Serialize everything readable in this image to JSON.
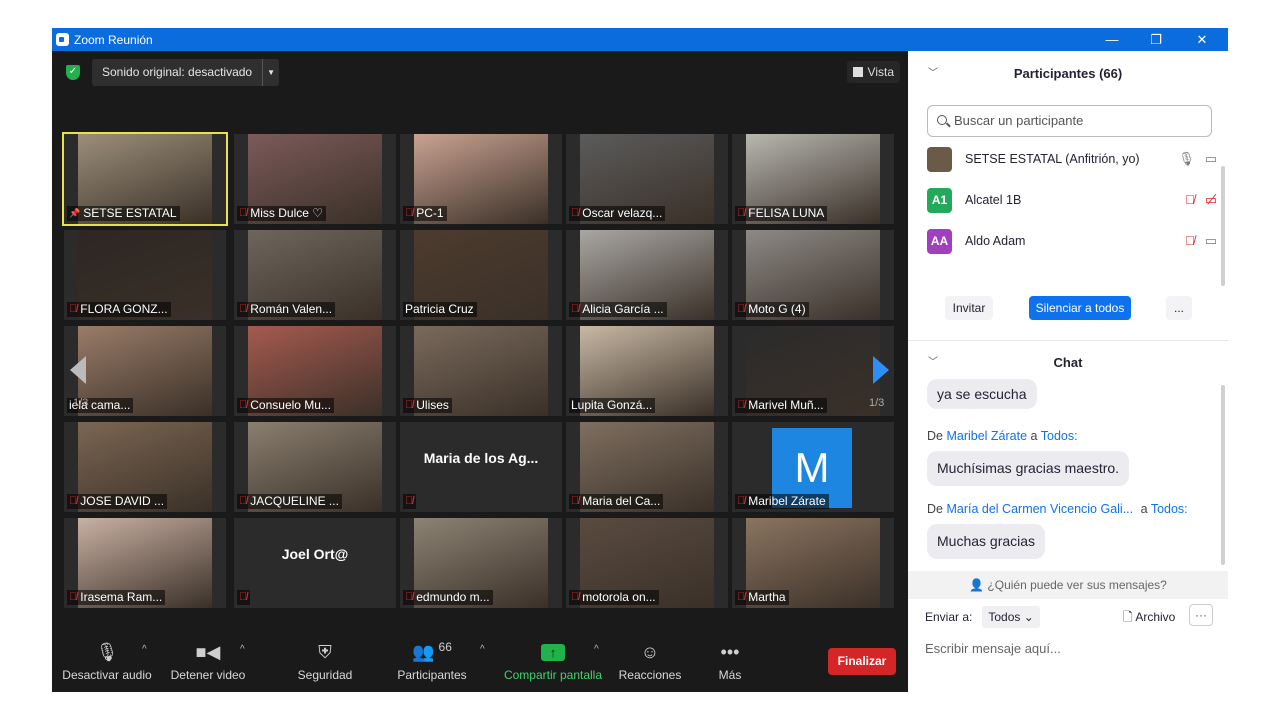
{
  "window": {
    "title": "Zoom Reunión",
    "minimize": "—",
    "restore": "❐",
    "close": "✕"
  },
  "meeting": {
    "sound_button": "Sonido original: desactivado",
    "view_button": "Vista",
    "page_left": "1/3",
    "page_right": "1/3",
    "tiles": [
      {
        "name": "SETSE ESTATAL",
        "muted": false,
        "color": "#9b8f7a"
      },
      {
        "name": "Miss Dulce ♡",
        "muted": true,
        "color": "#7c5a5a"
      },
      {
        "name": "PC-1",
        "muted": true,
        "color": "#c9a291"
      },
      {
        "name": "Oscar velazq...",
        "muted": true,
        "color": "#5b5b5b"
      },
      {
        "name": "FELISA LUNA",
        "muted": true,
        "color": "#b7b7b0"
      },
      {
        "name": "FLORA GONZ...",
        "muted": true,
        "color": "#2d2622"
      },
      {
        "name": "Román Valen...",
        "muted": true,
        "color": "#6e665c"
      },
      {
        "name": "Patricia Cruz",
        "muted": false,
        "color": "#4d3b2e"
      },
      {
        "name": "Alicia García ...",
        "muted": true,
        "color": "#a9a7a3"
      },
      {
        "name": "Moto G (4)",
        "muted": true,
        "color": "#8e8a86"
      },
      {
        "name": "iela cama...",
        "muted": false,
        "color": "#9a7c68"
      },
      {
        "name": "Consuelo Mu...",
        "muted": true,
        "color": "#a55a4f"
      },
      {
        "name": "Ulises",
        "muted": true,
        "color": "#7a6a5c"
      },
      {
        "name": "Lupita Gonzá...",
        "muted": false,
        "color": "#c8b8a4"
      },
      {
        "name": "Marivel Muñ...",
        "muted": true,
        "color": "#2b2b2b"
      },
      {
        "name": "JOSE DAVID ...",
        "muted": true,
        "color": "#7b6652"
      },
      {
        "name": "JACQUELINE ...",
        "muted": true,
        "color": "#8a7f6f"
      },
      {
        "name": "",
        "muted": true,
        "color": "#2b2b2b",
        "big": "Maria de los Ag..."
      },
      {
        "name": "Maria del Ca...",
        "muted": true,
        "color": "#7f6f60"
      },
      {
        "name": "Maribel Zárate",
        "muted": true,
        "color": "#2b2b2b",
        "letter": "M"
      },
      {
        "name": "Irasema Ram...",
        "muted": true,
        "color": "#c9b0a3"
      },
      {
        "name": "",
        "muted": true,
        "color": "#2b2b2b",
        "big": "Joel Ort@"
      },
      {
        "name": "edmundo m...",
        "muted": true,
        "color": "#8d8374"
      },
      {
        "name": "motorola on...",
        "muted": true,
        "color": "#5a4b40"
      },
      {
        "name": "Martha",
        "muted": true,
        "color": "#8b7460"
      }
    ]
  },
  "toolbar": {
    "mute": "Desactivar audio",
    "video": "Detener video",
    "security": "Seguridad",
    "participants": "Participantes",
    "participants_count": "66",
    "share": "Compartir pantalla",
    "reactions": "Reacciones",
    "more": "Más",
    "end": "Finalizar"
  },
  "participants": {
    "header": "Participantes (66)",
    "search_placeholder": "Buscar un participante",
    "list": [
      {
        "name": "SETSE ESTATAL (Anfitrión, yo)",
        "initials": "",
        "color": "#6b5a48"
      },
      {
        "name": "Alcatel 1B",
        "initials": "A1",
        "color": "#23a95a"
      },
      {
        "name": "Aldo Adam",
        "initials": "AA",
        "color": "#a23fbf"
      }
    ],
    "invite": "Invitar",
    "mute_all": "Silenciar a todos",
    "more": "..."
  },
  "chat": {
    "header": "Chat",
    "msg1": "ya se escucha",
    "from_prefix": "De",
    "to_word": "a",
    "sender2": "Maribel Zárate",
    "to2": "Todos:",
    "msg2": "Muchísimas gracias maestro.",
    "sender3": "María del Carmen Vicencio Gali...",
    "to3": "Todos:",
    "msg3": "Muchas gracias",
    "who_can_see": "¿Quién puede ver sus mensajes?",
    "send_to_label": "Enviar a:",
    "send_to_value": "Todos",
    "file": "Archivo",
    "compose_placeholder": "Escribir mensaje aquí..."
  }
}
